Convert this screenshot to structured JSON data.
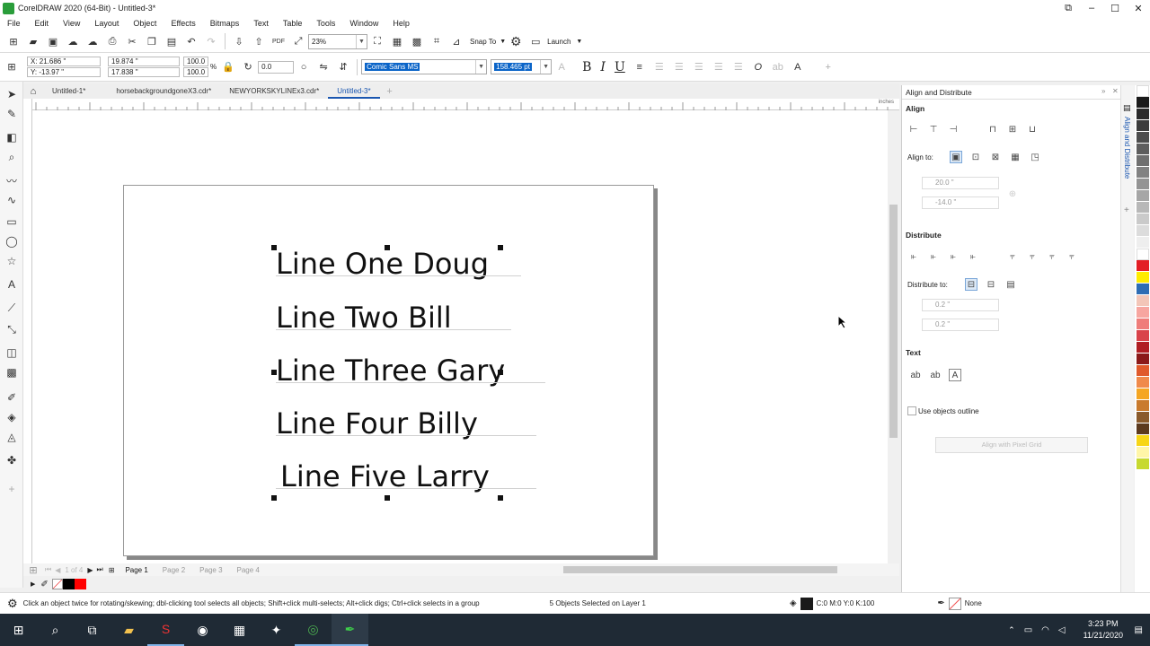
{
  "window": {
    "title": "CorelDRAW 2020 (64-Bit) - Untitled-3*"
  },
  "menu": [
    "File",
    "Edit",
    "View",
    "Layout",
    "Object",
    "Effects",
    "Bitmaps",
    "Text",
    "Table",
    "Tools",
    "Window",
    "Help"
  ],
  "toolbar": {
    "zoom": "23%",
    "snap_to": "Snap To",
    "launch": "Launch"
  },
  "propbar": {
    "x": "X: 21.686 \"",
    "y": "Y: -13.97 \"",
    "w": "19.874 \"",
    "h": "17.838 \"",
    "scale_w": "100.0",
    "scale_h": "100.0",
    "scale_unit": "%",
    "rotation": "0.0",
    "font": "Comic Sans MS",
    "size": "158.465 pt",
    "bold": "B",
    "italic": "I",
    "underline": "U"
  },
  "doc_tabs": [
    "Untitled-1*",
    "horsebackgroundgoneX3.cdr*",
    "NEWYORKSKYLINEx3.cdr*",
    "Untitled-3*"
  ],
  "ruler_unit": "inches",
  "text_lines": [
    "Line One Doug",
    "Line Two Bill",
    "Line Three Gary",
    "Line Four Billy",
    "Line Five Larry"
  ],
  "pages": [
    "Page 1",
    "Page 2",
    "Page 3",
    "Page 4"
  ],
  "page_counter": "1 of 4",
  "status": {
    "hint": "Click an object twice for rotating/skewing; dbl-clicking tool selects all objects; Shift+click multi-selects; Alt+click digs; Ctrl+click selects in a group",
    "selection": "5 Objects Selected on Layer 1",
    "fill": "C:0 M:0 Y:0 K:100",
    "outline": "None"
  },
  "dock": {
    "title": "Align and Distribute",
    "side_tab": "Align and Distribute",
    "align": "Align",
    "align_to": "Align to:",
    "x_val": "20.0 \"",
    "y_val": "-14.0 \"",
    "distribute": "Distribute",
    "distribute_to": "Distribute to:",
    "h_val": "0.2 \"",
    "v_val": "0.2 \"",
    "text": "Text",
    "use_outline": "Use objects outline",
    "align_grid": "Align with Pixel Grid"
  },
  "palette": [
    "#ffffff",
    "#1a1a1a",
    "#2b2b2b",
    "#3c3c3c",
    "#4d4d4d",
    "#5e5e5e",
    "#707070",
    "#828282",
    "#949494",
    "#a6a6a6",
    "#b8b8b8",
    "#cacaca",
    "#dcdcdc",
    "#eeeeee",
    "#ffffff",
    "#e31e24",
    "#ffec00",
    "#2e6db4",
    "#f3c6b8",
    "#f7a6a0",
    "#ef7d7a",
    "#d9434a",
    "#b01e23",
    "#8b1a1a",
    "#e05a2b",
    "#f08a4b",
    "#f5a623",
    "#c97b2e",
    "#8a5a2b",
    "#5c3a1e",
    "#f7d617",
    "#fff6a8",
    "#c7d92f"
  ],
  "colors": {
    "accent": "#1a56b0",
    "selection": "#0a64c8",
    "red_swatch": "#ff0000"
  },
  "taskbar": {
    "time": "3:23 PM",
    "date": "11/21/2020"
  }
}
